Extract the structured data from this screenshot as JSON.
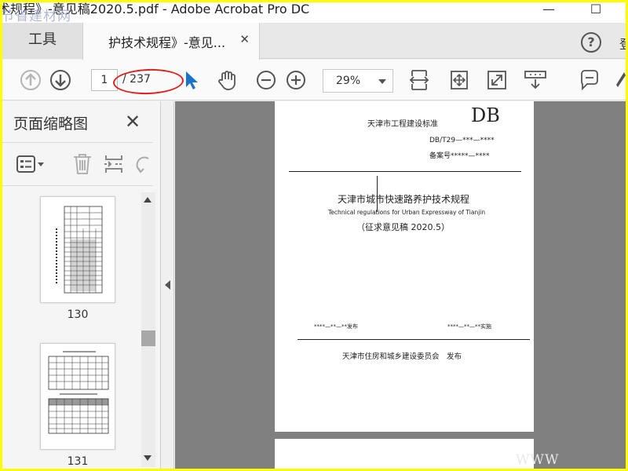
{
  "window": {
    "title": "术规程》-意见稿2020.5.pdf - Adobe Acrobat Pro DC",
    "watermark": "节省建材网",
    "minimize_glyph": "—",
    "maximize_glyph": "☐"
  },
  "tabs": {
    "tools_label": "工具",
    "doc_label": "护技术规程》-意见...",
    "close_glyph": "✕",
    "help_glyph": "?",
    "signin_label": "登"
  },
  "toolbar": {
    "current_page": "1",
    "total_pages": "/ 237",
    "zoom": "29%",
    "annotation_color": "#e02020",
    "accent": "#1a73c8"
  },
  "sidepane": {
    "title": "页面缩略图",
    "close_glyph": "✕",
    "thumbnails": [
      {
        "label": "130"
      },
      {
        "label": "131"
      }
    ]
  },
  "document": {
    "header_standard": "天津市工程建设标准",
    "db": "DB",
    "code": "DB/T29—***—****",
    "record_no": "备案号*****—****",
    "title_cn": "天津市城市快速路养护技术规程",
    "title_en": "Technical regulations for Urban Expressway of Tianjin",
    "draft": "（征求意见稿 2020.5）",
    "publish_date": "****—**—**发布",
    "effective_date": "****—**—**实施",
    "publisher": "天津市住房和城乡建设委员会　发布",
    "watermark_text": "WWW"
  }
}
